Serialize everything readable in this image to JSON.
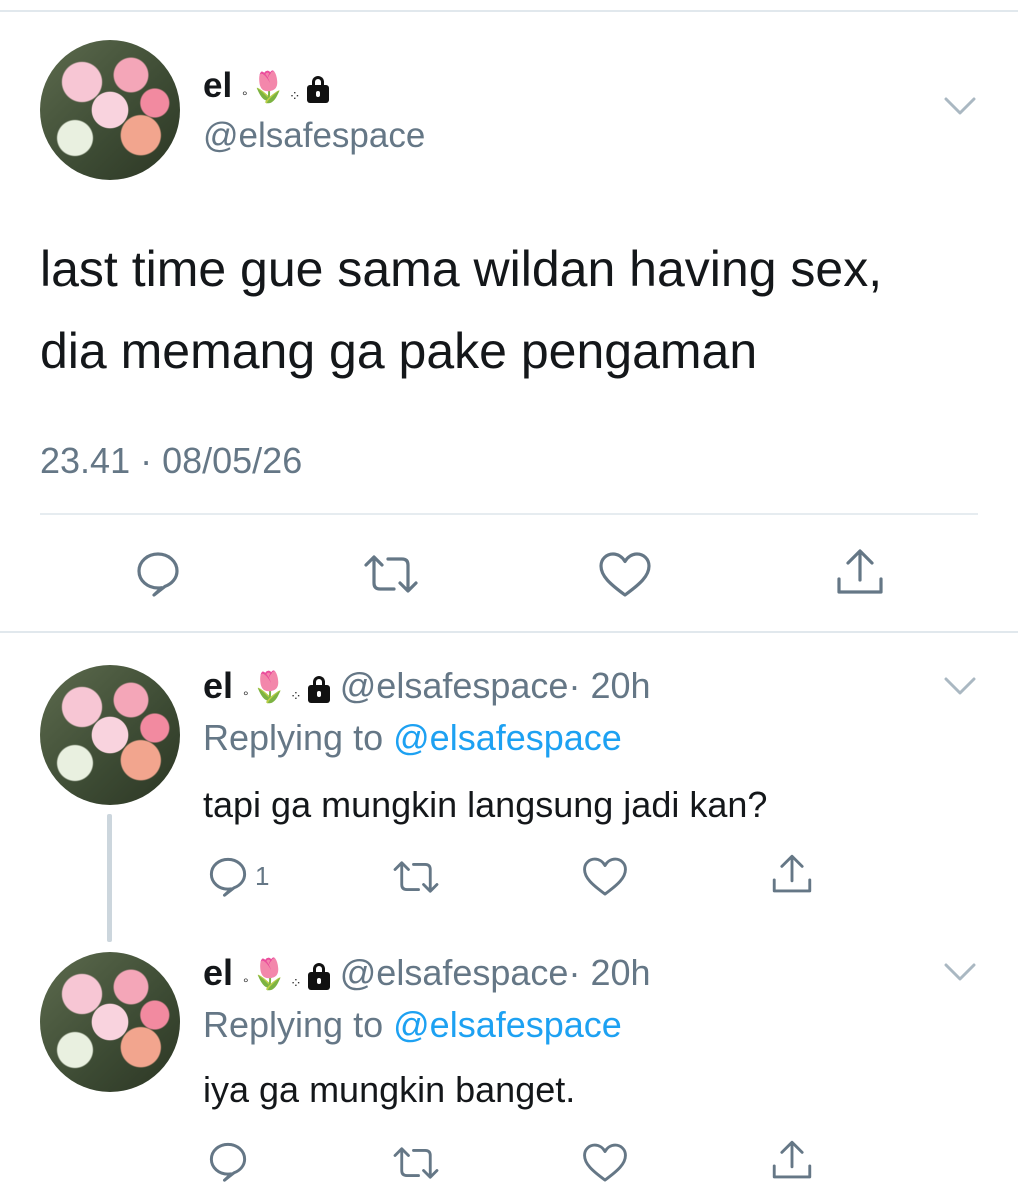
{
  "main_tweet": {
    "display_name": "el",
    "handle": "@elsafespace",
    "text_line1": "last time gue sama wildan having sex,",
    "text_line2": "dia memang ga pake pengaman",
    "timestamp": "23.41 · 08/05/26"
  },
  "replies": [
    {
      "display_name": "el",
      "handle": "@elsafespace",
      "time": "· 20h",
      "replying_prefix": "Replying to",
      "replying_handle": "@elsafespace",
      "text": "tapi ga mungkin langsung jadi kan?",
      "reply_count": "1"
    },
    {
      "display_name": "el",
      "handle": "@elsafespace",
      "time": "· 20h",
      "replying_prefix": "Replying to",
      "replying_handle": "@elsafespace",
      "text": "iya ga mungkin banget."
    }
  ],
  "colors": {
    "link": "#1da1f2",
    "muted": "#657786",
    "icon": "#657786",
    "divider": "#e6ecf0"
  },
  "icons": [
    "reply-icon",
    "retweet-icon",
    "like-icon",
    "share-icon",
    "chevron-down-icon",
    "lock-icon",
    "tulip-emoji"
  ]
}
